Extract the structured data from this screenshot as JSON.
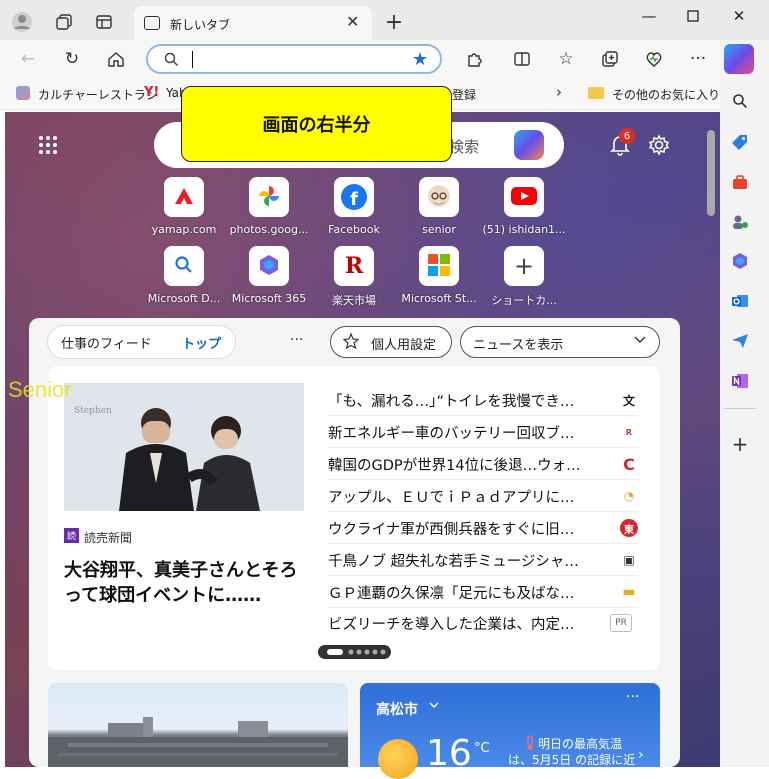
{
  "browser": {
    "tab_title": "新しいタブ",
    "address_value": "",
    "favorites": [
      {
        "label": "カルチャーレストラン"
      },
      {
        "label": "Yah"
      },
      {
        "label": "登録"
      },
      {
        "label": "その他のお気に入り"
      }
    ]
  },
  "annotation": {
    "text": "画面の右半分"
  },
  "search": {
    "placeholder_fragment": "検索"
  },
  "notifications": {
    "count": "6"
  },
  "quicklinks": [
    {
      "label": "yamap.com",
      "icon": "yamap-icon"
    },
    {
      "label": "photos.goog...",
      "icon": "google-photos-icon"
    },
    {
      "label": "Facebook",
      "icon": "facebook-icon"
    },
    {
      "label": "senior",
      "icon": "senior-icon"
    },
    {
      "label": "(51) ishidan1...",
      "icon": "youtube-icon"
    },
    {
      "label": "Microsoft D...",
      "icon": "microsoft-search-icon"
    },
    {
      "label": "Microsoft 365",
      "icon": "microsoft365-icon"
    },
    {
      "label": "楽天市場",
      "icon": "rakuten-icon"
    },
    {
      "label": "Microsoft St...",
      "icon": "microsoft-store-icon"
    },
    {
      "label": "ショートカ...",
      "icon": "plus-icon"
    }
  ],
  "feed": {
    "tab_work": "仕事のフィード",
    "tab_top": "トップ",
    "more": "···",
    "personalize_label": "個人用設定",
    "news_label": "ニュースを表示",
    "watermark": "Senior",
    "main_source": "読売新聞",
    "main_headline": "大谷翔平、真美子さんとそろって球団イベントに……",
    "headlines": [
      {
        "text": "「も、漏れる…」”トイレを我慢でき…",
        "src": "文"
      },
      {
        "text": "新エネルギー車のバッテリー回収ブ…",
        "src": "R"
      },
      {
        "text": "韓国のGDPが世界14位に後退…ウォ…",
        "src": "C"
      },
      {
        "text": "アップル、ＥＵでｉＰａｄアプリに…",
        "src": "◔"
      },
      {
        "text": "ウクライナ軍が西側兵器をすぐに旧…",
        "src": "東"
      },
      {
        "text": "千鳥ノブ 超失礼な若手ミュージシャ…",
        "src": "▣"
      },
      {
        "text": "ＧＰ連覇の久保凛「足元にも及ばな…",
        "src": "▬"
      },
      {
        "text": "ビズリーチを導入した企業は、内定…",
        "src": "PR"
      }
    ]
  },
  "weather": {
    "city": "高松市",
    "temp": "16",
    "unit": "°C",
    "note_line1": "明日の最高気温",
    "note_line2": "は、5月5日 の記録に近"
  }
}
